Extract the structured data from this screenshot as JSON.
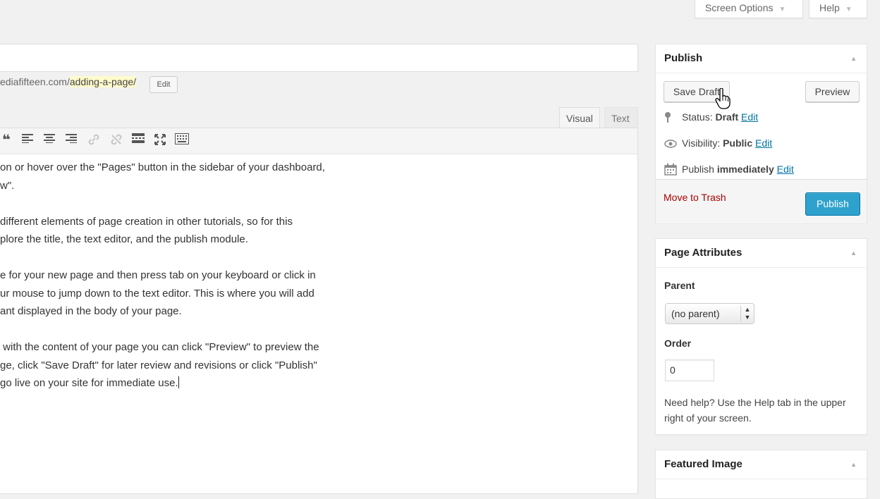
{
  "screen_meta": {
    "screen_options_label": "Screen Options",
    "help_label": "Help",
    "arrow": "▼"
  },
  "permalink": {
    "prefix": "ediafifteen.com/",
    "slug": "adding-a-page/",
    "edit_label": "Edit"
  },
  "editor": {
    "tabs": {
      "visual": "Visual",
      "text": "Text"
    },
    "toolbar_icons": [
      "blockquote-icon",
      "align-left-icon",
      "align-center-icon",
      "align-right-icon",
      "link-icon",
      "unlink-icon",
      "read-more-icon",
      "fullscreen-icon",
      "toolbar-toggle-icon"
    ],
    "lines": [
      "on or hover over the \"Pages\" button in the sidebar of your dashboard,",
      "w\".",
      "",
      "different elements of page creation in other tutorials, so for this",
      "plore the title, the text editor, and the publish module.",
      "",
      "e for your new page and then press tab on your keyboard or click in",
      "ur mouse to jump down to the text editor. This is where you will add",
      "ant displayed in the body of your page.",
      "",
      " with the content of your page you can click \"Preview\" to preview the",
      "ge, click \"Save Draft\" for later review and revisions or click \"Publish\"",
      "go live on your site for immediate use."
    ]
  },
  "publish_box": {
    "title": "Publish",
    "save_draft_label": "Save Draft",
    "preview_label": "Preview",
    "status_label": "Status:",
    "status_value": "Draft",
    "visibility_label": "Visibility:",
    "visibility_value": "Public",
    "schedule_label": "Publish",
    "schedule_value": "immediately",
    "edit_link": "Edit",
    "trash_label": "Move to Trash",
    "publish_label": "Publish"
  },
  "page_attributes": {
    "title": "Page Attributes",
    "parent_label": "Parent",
    "parent_value": "(no parent)",
    "order_label": "Order",
    "order_value": "0",
    "help_text": "Need help? Use the Help tab in the upper right of your screen."
  },
  "featured_image": {
    "title": "Featured Image"
  },
  "colors": {
    "primary": "#2ea2cc",
    "link": "#0074a2",
    "trash": "#aa0000",
    "slug_highlight": "#fffbcc"
  }
}
